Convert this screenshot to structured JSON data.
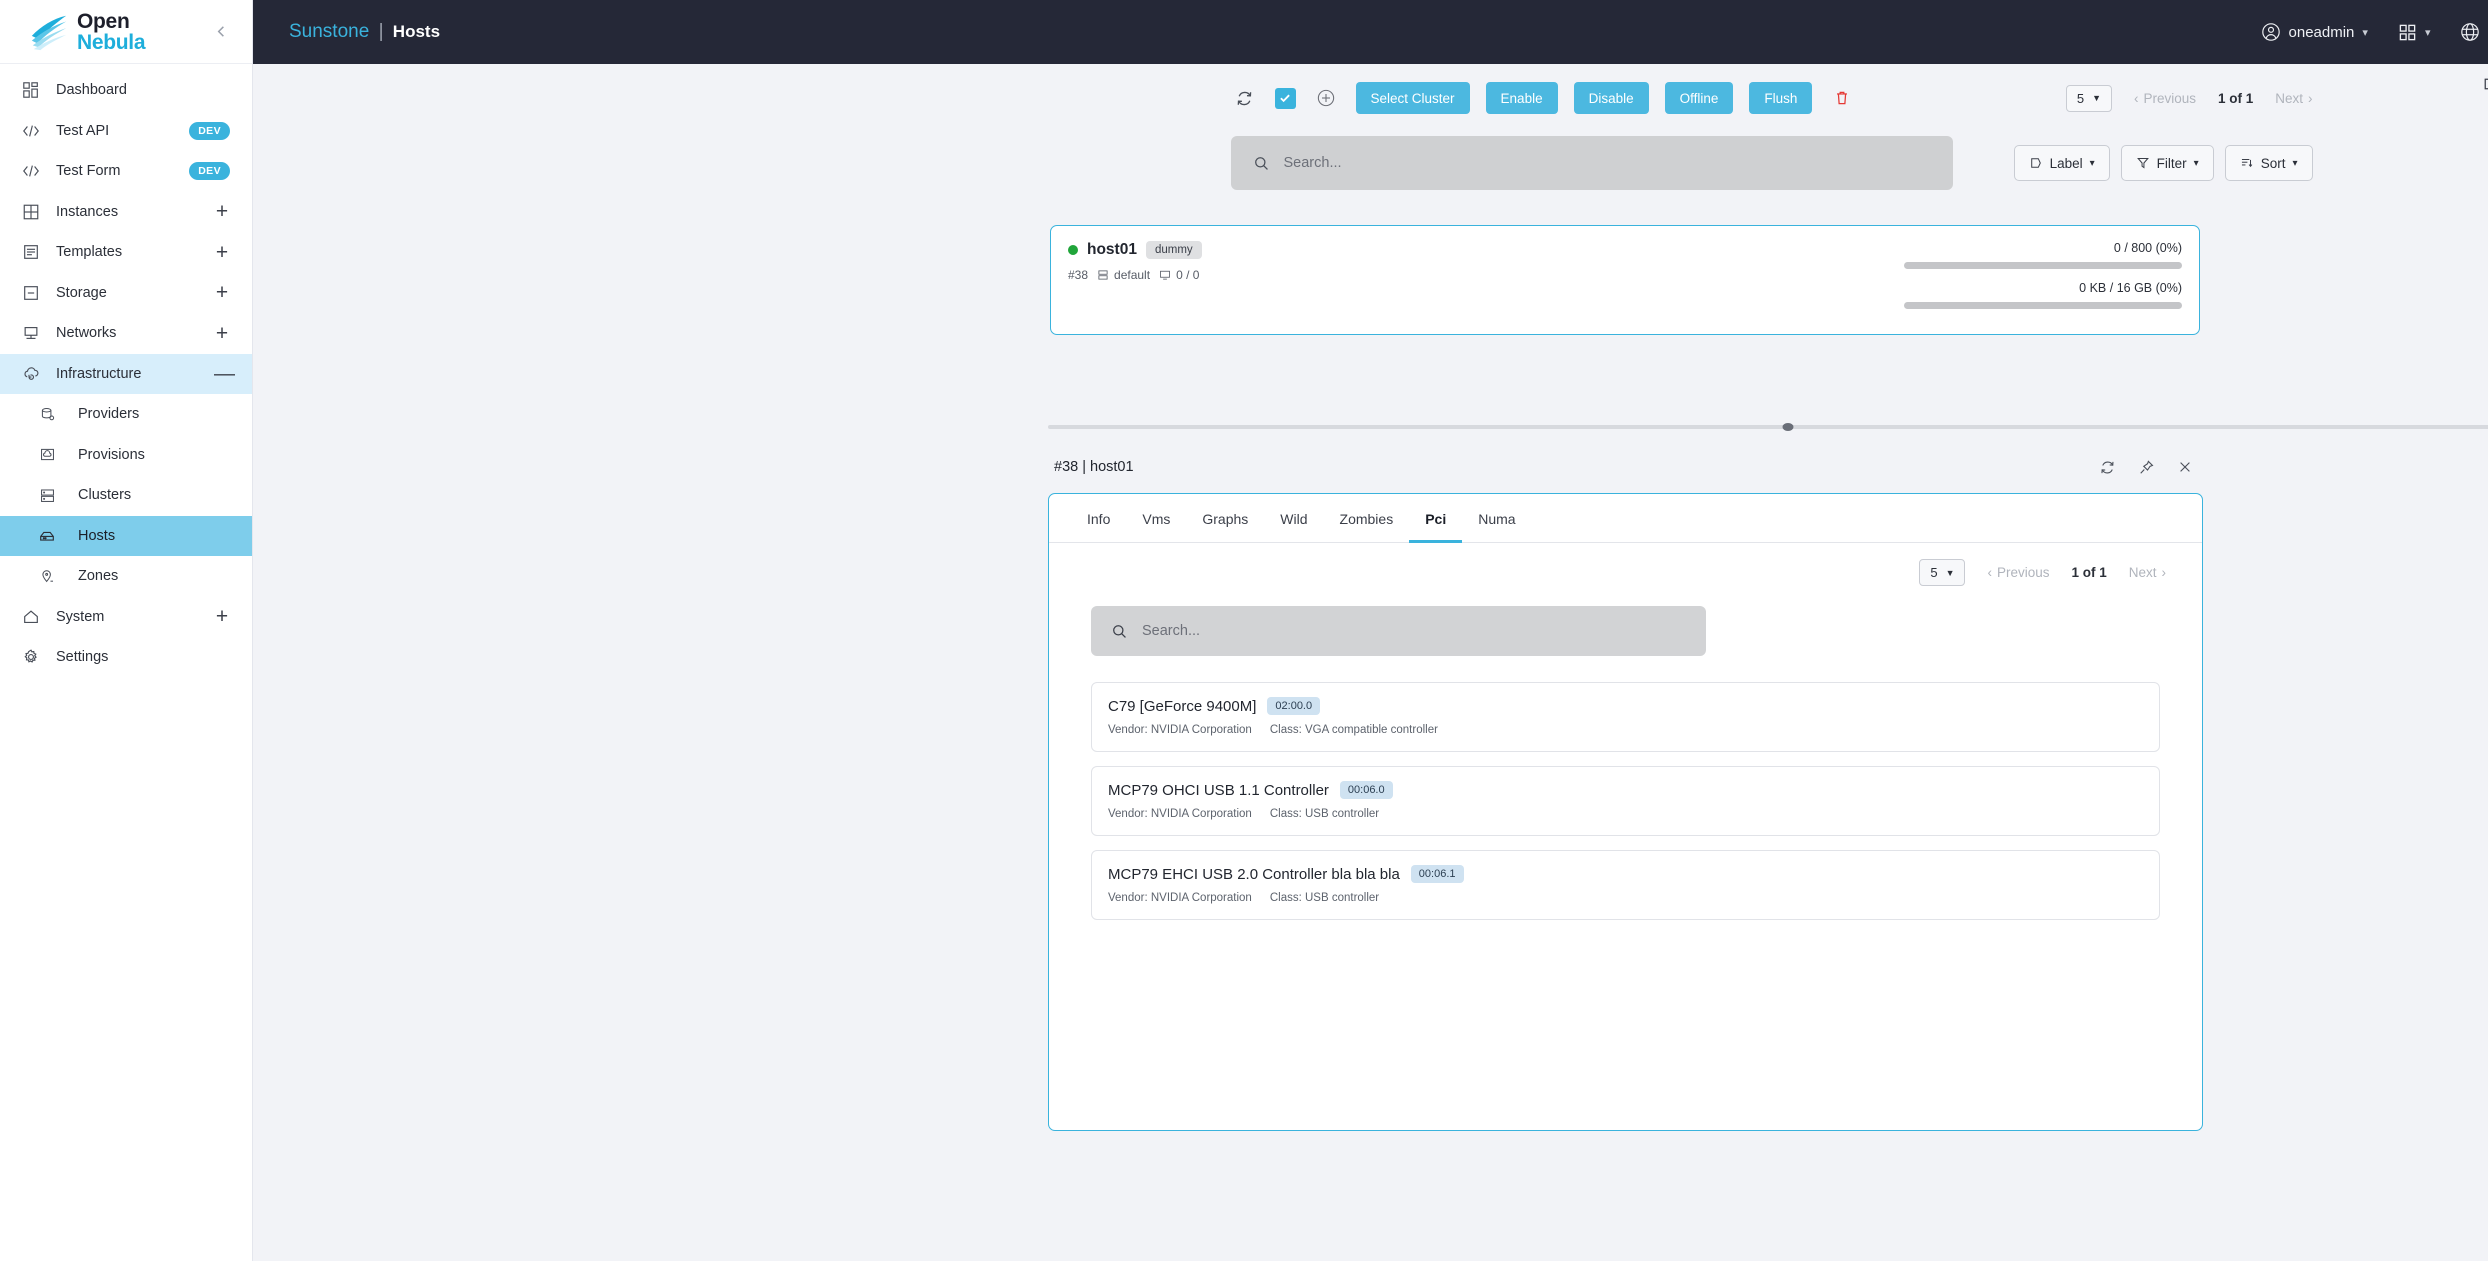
{
  "sidebar": {
    "logo": {
      "line1": "Open",
      "line2": "Nebula",
      "icon": "opennebula-logo"
    },
    "collapse_icon": "chevron-left-icon",
    "items": [
      {
        "label": "Dashboard",
        "icon": "dashboard-grid-icon",
        "state": "normal"
      },
      {
        "label": "Test API",
        "icon": "code-icon",
        "badge": "DEV",
        "state": "normal"
      },
      {
        "label": "Test Form",
        "icon": "code-icon",
        "badge": "DEV",
        "state": "normal"
      },
      {
        "label": "Instances",
        "icon": "instances-grid-icon",
        "expander": "+",
        "state": "normal"
      },
      {
        "label": "Templates",
        "icon": "templates-icon",
        "expander": "+",
        "state": "normal"
      },
      {
        "label": "Storage",
        "icon": "storage-icon",
        "expander": "+",
        "state": "normal"
      },
      {
        "label": "Networks",
        "icon": "networks-icon",
        "expander": "+",
        "state": "normal"
      },
      {
        "label": "Infrastructure",
        "icon": "cloud-sync-icon",
        "expander": "—",
        "state": "parent-open"
      },
      {
        "label": "Providers",
        "icon": "database-gear-icon",
        "state": "sub"
      },
      {
        "label": "Provisions",
        "icon": "cloud-box-icon",
        "state": "sub"
      },
      {
        "label": "Clusters",
        "icon": "clusters-icon",
        "state": "sub"
      },
      {
        "label": "Hosts",
        "icon": "host-icon",
        "state": "sub-active"
      },
      {
        "label": "Zones",
        "icon": "zone-pin-icon",
        "state": "sub"
      },
      {
        "label": "System",
        "icon": "home-icon",
        "expander": "+",
        "state": "normal"
      },
      {
        "label": "Settings",
        "icon": "gear-icon",
        "state": "normal"
      }
    ]
  },
  "topbar": {
    "brand": "Sunstone",
    "separator": "|",
    "page": "Hosts",
    "user": "oneadmin",
    "user_icon": "user-circle-icon",
    "apps_icon": "apps-grid-icon",
    "language_icon": "globe-icon"
  },
  "toolbar": {
    "refresh_icon": "refresh-icon",
    "select_all_checkbox": "checked",
    "add_icon": "plus-circle-icon",
    "buttons": [
      {
        "label": "Select Cluster"
      },
      {
        "label": "Enable"
      },
      {
        "label": "Disable"
      },
      {
        "label": "Offline"
      },
      {
        "label": "Flush"
      }
    ],
    "delete_icon": "trash-icon",
    "popout_icon": "external-link-icon"
  },
  "pagination": {
    "per_page": "5",
    "previous": "Previous",
    "current": "1 of 1",
    "next": "Next"
  },
  "search": {
    "placeholder": "Search..."
  },
  "filters": [
    {
      "label": "Label",
      "icon": "label-tag-icon"
    },
    {
      "label": "Filter",
      "icon": "funnel-icon"
    },
    {
      "label": "Sort",
      "icon": "sort-icon"
    }
  ],
  "host_card": {
    "status": "on",
    "name": "host01",
    "type_chip": "dummy",
    "id": "#38",
    "cluster_icon": "cluster-icon",
    "cluster": "default",
    "vms_icon": "monitor-icon",
    "vms": "0 / 0",
    "cpu_metric": "0 / 800 (0%)",
    "cpu_percent": 0,
    "mem_metric": "0 KB / 16 GB (0%)",
    "mem_percent": 0
  },
  "detail": {
    "title": "#38 | host01",
    "refresh_icon": "refresh-icon",
    "pin_icon": "pin-icon",
    "close_icon": "close-icon",
    "tabs": [
      {
        "label": "Info",
        "active": false
      },
      {
        "label": "Vms",
        "active": false
      },
      {
        "label": "Graphs",
        "active": false
      },
      {
        "label": "Wild",
        "active": false
      },
      {
        "label": "Zombies",
        "active": false
      },
      {
        "label": "Pci",
        "active": true
      },
      {
        "label": "Numa",
        "active": false
      }
    ],
    "pagination": {
      "per_page": "5",
      "previous": "Previous",
      "current": "1 of 1",
      "next": "Next"
    },
    "search": {
      "placeholder": "Search..."
    },
    "pci_devices": [
      {
        "name": "C79 [GeForce 9400M]",
        "address": "02:00.0",
        "vendor": "Vendor: NVIDIA Corporation",
        "class": "Class: VGA compatible controller"
      },
      {
        "name": "MCP79 OHCI USB 1.1 Controller",
        "address": "00:06.0",
        "vendor": "Vendor: NVIDIA Corporation",
        "class": "Class: USB controller"
      },
      {
        "name": "MCP79 EHCI USB 2.0 Controller bla bla bla",
        "address": "00:06.1",
        "vendor": "Vendor: NVIDIA Corporation",
        "class": "Class: USB controller"
      }
    ]
  },
  "colors": {
    "accent": "#3ab3dd",
    "topbar_bg": "#252837",
    "active_nav": "#7ecdeb",
    "parent_nav": "#d7eefb",
    "danger": "#e53935",
    "status_on": "#20a53a",
    "page_bg": "#f2f3f7"
  }
}
